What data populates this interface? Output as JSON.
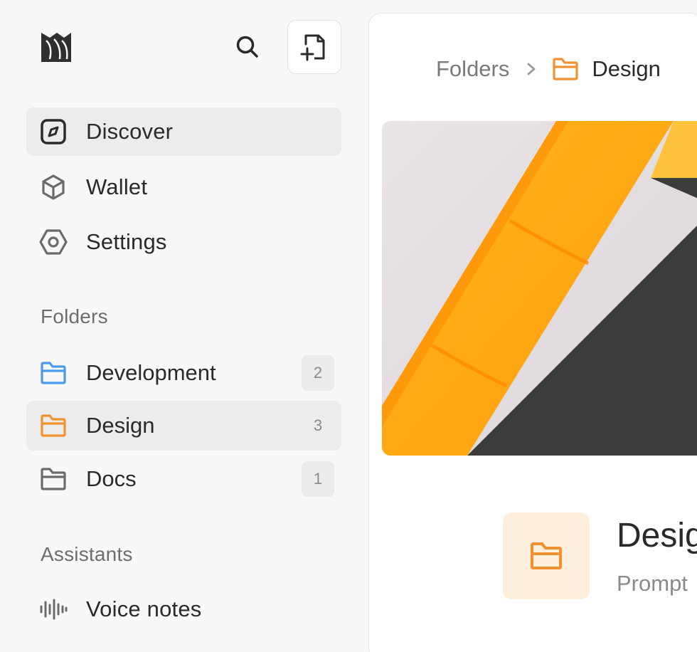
{
  "sidebar": {
    "nav": [
      {
        "label": "Discover",
        "icon": "compass-icon",
        "active": true
      },
      {
        "label": "Wallet",
        "icon": "cube-icon",
        "active": false
      },
      {
        "label": "Settings",
        "icon": "hexagon-gear-icon",
        "active": false
      }
    ],
    "folders_title": "Folders",
    "folders": [
      {
        "label": "Development",
        "count": "2",
        "icon": "folder-icon",
        "color": "#4a9bf0"
      },
      {
        "label": "Design",
        "count": "3",
        "icon": "folder-icon",
        "color": "#f2912f"
      },
      {
        "label": "Docs",
        "count": "1",
        "icon": "folder-icon",
        "color": "#6b6b6b"
      }
    ],
    "assistants_title": "Assistants",
    "assistants": [
      {
        "label": "Voice notes",
        "icon": "waveform-icon"
      }
    ]
  },
  "breadcrumb": {
    "root": "Folders",
    "current": "Design"
  },
  "folder_header": {
    "title": "Desig",
    "subtitle": "Prompt"
  },
  "colors": {
    "accent_orange": "#f2912f",
    "accent_blue": "#4a9bf0",
    "tile_bg": "#fdefdc"
  }
}
